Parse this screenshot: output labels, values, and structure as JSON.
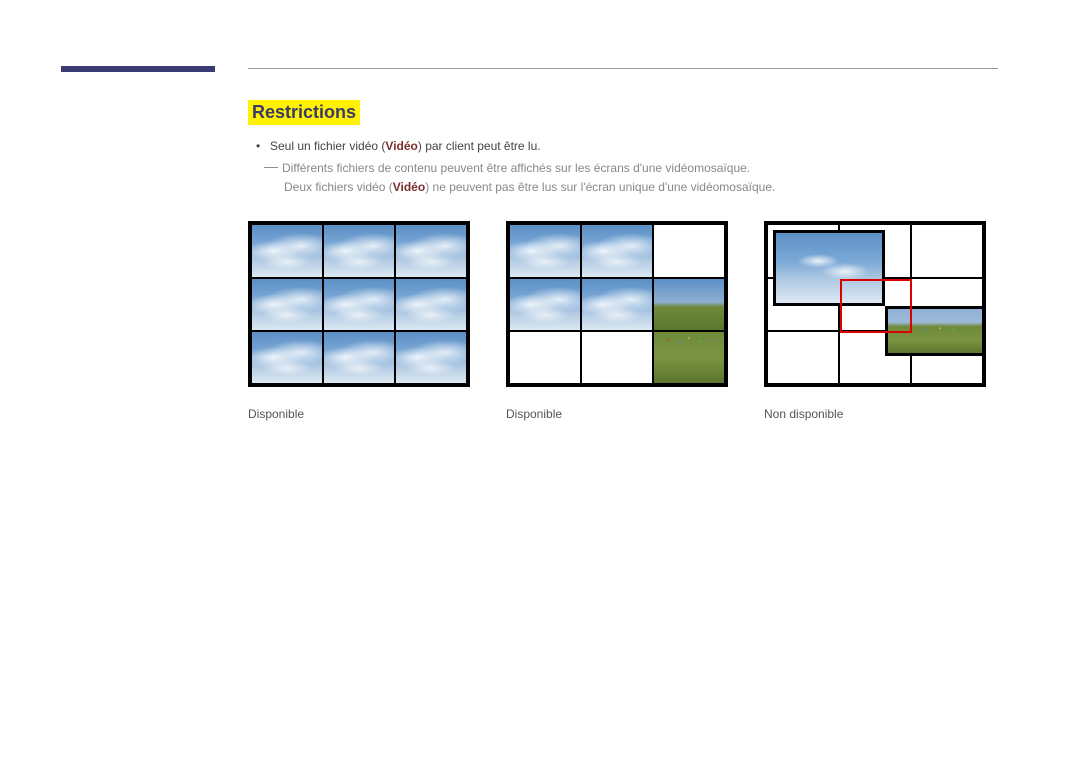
{
  "heading": "Restrictions",
  "bullet1_pre": "Seul un fichier vidéo (",
  "bullet1_video": "Vidéo",
  "bullet1_post": ") par client peut être lu.",
  "sub_line1": "Différents fichiers de contenu peuvent être affichés sur les écrans d'une vidéomosaïque.",
  "sub_line2_pre": "Deux fichiers vidéo (",
  "sub_line2_video": "Vidéo",
  "sub_line2_post": ") ne peuvent pas être lus sur l'écran unique d'une vidéomosaïque.",
  "captions": {
    "c1": "Disponible",
    "c2": "Disponible",
    "c3": "Non disponible"
  }
}
